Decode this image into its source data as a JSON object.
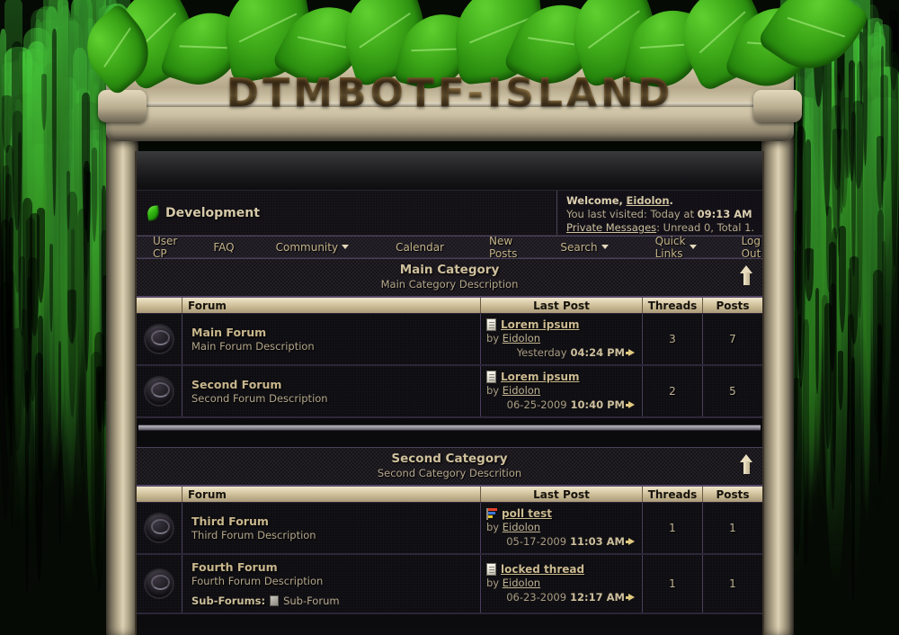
{
  "site": {
    "logo_text": "DTMBOTF-ISLAND"
  },
  "board": {
    "title": "Development",
    "leaf_icon": "leaf-icon"
  },
  "welcome": {
    "greeting_prefix": "Welcome,",
    "username": "Eidolon",
    "greeting_suffix": ".",
    "last_visit_label": "You last visited: Today at",
    "last_visit_time": "09:13 AM",
    "pm_label": "Private Messages",
    "pm_status": ": Unread 0, Total 1."
  },
  "nav": {
    "items": [
      {
        "label": "User CP",
        "caret": false
      },
      {
        "label": "FAQ",
        "caret": false
      },
      {
        "label": "Community",
        "caret": true
      },
      {
        "label": "Calendar",
        "caret": false
      },
      {
        "label": "New Posts",
        "caret": false
      },
      {
        "label": "Search",
        "caret": true
      },
      {
        "label": "Quick Links",
        "caret": true
      },
      {
        "label": "Log Out",
        "caret": false
      }
    ]
  },
  "columns": {
    "icon": "",
    "forum": "Forum",
    "last_post": "Last Post",
    "threads": "Threads",
    "posts": "Posts"
  },
  "categories": [
    {
      "title": "Main Category",
      "description": "Main Category Description",
      "forums": [
        {
          "name": "Main Forum",
          "description": "Main Forum Description",
          "last_post": {
            "icon": "paper-icon",
            "title": "Lorem ipsum",
            "by_label": "by",
            "author": "Eidolon",
            "date": "Yesterday",
            "time": "04:24 PM"
          },
          "threads": "3",
          "posts": "7",
          "subforums": []
        },
        {
          "name": "Second Forum",
          "description": "Second Forum Description",
          "last_post": {
            "icon": "paper-icon",
            "title": "Lorem ipsum",
            "by_label": "by",
            "author": "Eidolon",
            "date": "06-25-2009",
            "time": "10:40 PM"
          },
          "threads": "2",
          "posts": "5",
          "subforums": []
        }
      ]
    },
    {
      "title": "Second Category",
      "description": "Second Category Descrition",
      "forums": [
        {
          "name": "Third Forum",
          "description": "Third Forum Description",
          "last_post": {
            "icon": "poll-icon",
            "title": "poll test",
            "by_label": "by",
            "author": "Eidolon",
            "date": "05-17-2009",
            "time": "11:03 AM"
          },
          "threads": "1",
          "posts": "1",
          "subforums": []
        },
        {
          "name": "Fourth Forum",
          "description": "Fourth Forum Description",
          "subforums_label": "Sub-Forums:",
          "subforums": [
            "Sub-Forum"
          ],
          "last_post": {
            "icon": "paper-icon",
            "title": "locked thread",
            "by_label": "by",
            "author": "Eidolon",
            "date": "06-23-2009",
            "time": "12:17 AM"
          },
          "threads": "1",
          "posts": "1"
        }
      ]
    }
  ],
  "theme": {
    "accent_gold": "#cfc09c",
    "header_bar": "#d8caa6",
    "link_gold": "#ccbb92",
    "leaf_green": "#3da818",
    "border_purple": "#4a3f5e"
  }
}
